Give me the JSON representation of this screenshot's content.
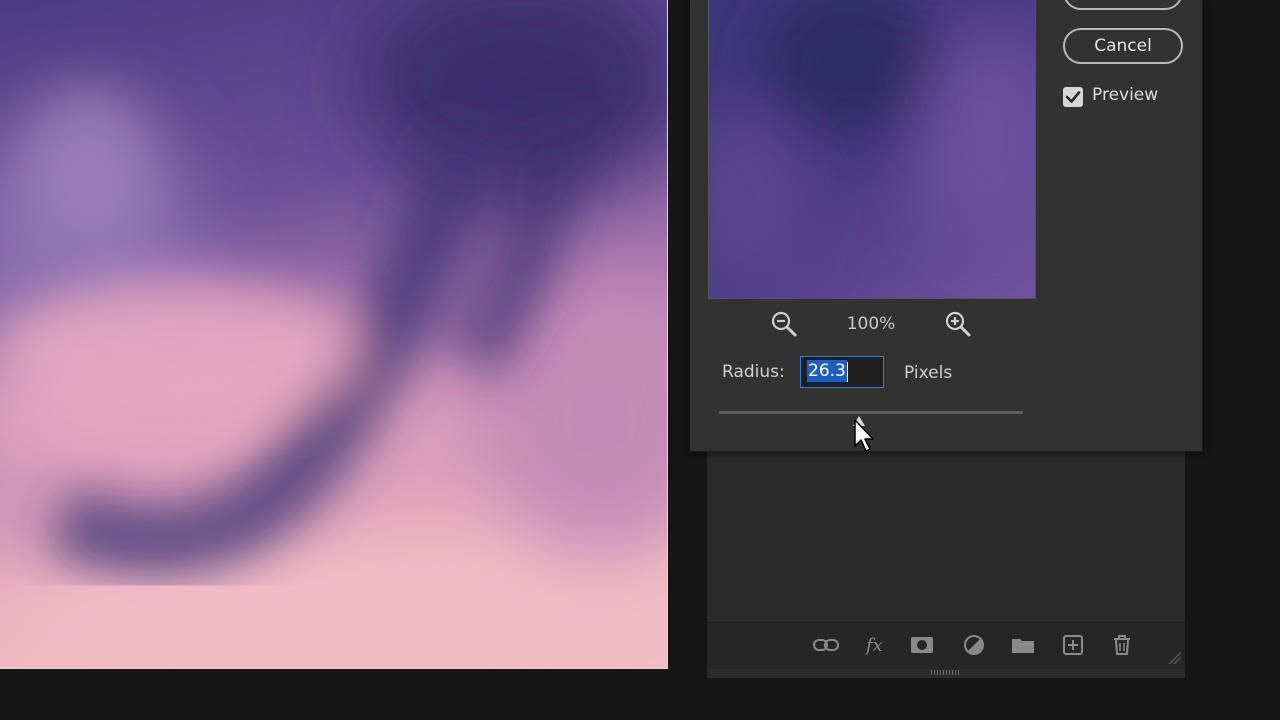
{
  "dialog": {
    "ok_label": "",
    "cancel_label": "Cancel",
    "preview_label": "Preview",
    "preview_checked": true,
    "zoom_level": "100%",
    "radius_label": "Radius:",
    "radius_value": "26.3",
    "radius_unit": "Pixels",
    "slider_value_fraction": 0.46
  },
  "icons": {
    "zoom_out": "zoom-out-icon",
    "zoom_in": "zoom-in-icon",
    "checkmark": "checkmark-icon",
    "cursor": "arrow-cursor-icon"
  },
  "layers_footer_icons": [
    "link-layers-icon",
    "fx-icon",
    "layer-mask-icon",
    "adjustment-layer-icon",
    "folder-icon",
    "new-layer-icon",
    "trash-icon"
  ],
  "colors": {
    "accent": "#1f5fbf",
    "dialog_bg": "#323232",
    "panel_bg": "#2b2b2b",
    "canvas_top": "#4a3b7e",
    "canvas_bottom": "#f0b8c0"
  }
}
